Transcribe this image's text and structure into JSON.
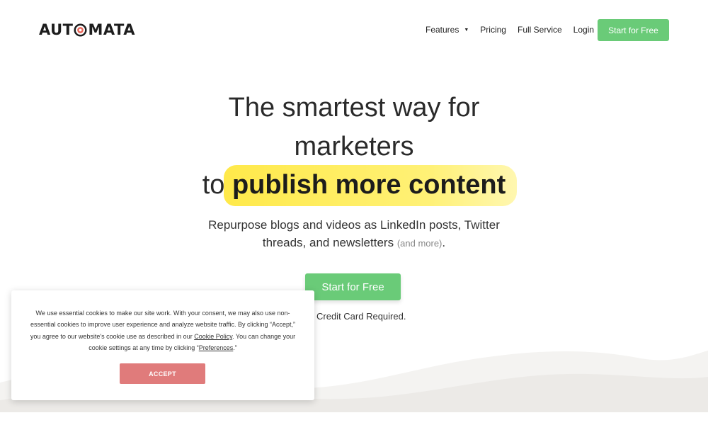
{
  "nav": {
    "logo_prefix": "AUT",
    "logo_suffix": "MATA",
    "links": [
      {
        "label": "Features",
        "has_dropdown": true
      },
      {
        "label": "Pricing"
      },
      {
        "label": "Full Service"
      },
      {
        "label": "Login"
      }
    ],
    "cta_label": "Start for Free"
  },
  "hero": {
    "title_line1": "The smartest way for",
    "title_line2": "marketers",
    "title_line3_prefix": "to",
    "title_highlight": "publish more content",
    "subtitle_line1": "Repurpose blogs and videos as LinkedIn posts, Twitter",
    "subtitle_line2": "threads, and newsletters",
    "subtitle_muted": "(and more)",
    "subtitle_end": ".",
    "cta_label": "Start for Free",
    "note": "Credit Card Required."
  },
  "cookie": {
    "text_part1": "We use essential cookies to make our site work. With your consent, we may also use non-essential cookies to improve user experience and analyze website traffic. By clicking “Accept,” you agree to our website's cookie use as described in our ",
    "policy_link": "Cookie Policy",
    "text_part2": ". You can change your cookie settings at any time by clicking “",
    "preferences_link": "Preferences",
    "text_part3": ".”",
    "accept_label": "ACCEPT"
  },
  "colors": {
    "accent_green": "#6acb78",
    "highlight_yellow": "#ffe94a",
    "accept_red": "#e07b7b",
    "logo_target": "#e9665a"
  }
}
